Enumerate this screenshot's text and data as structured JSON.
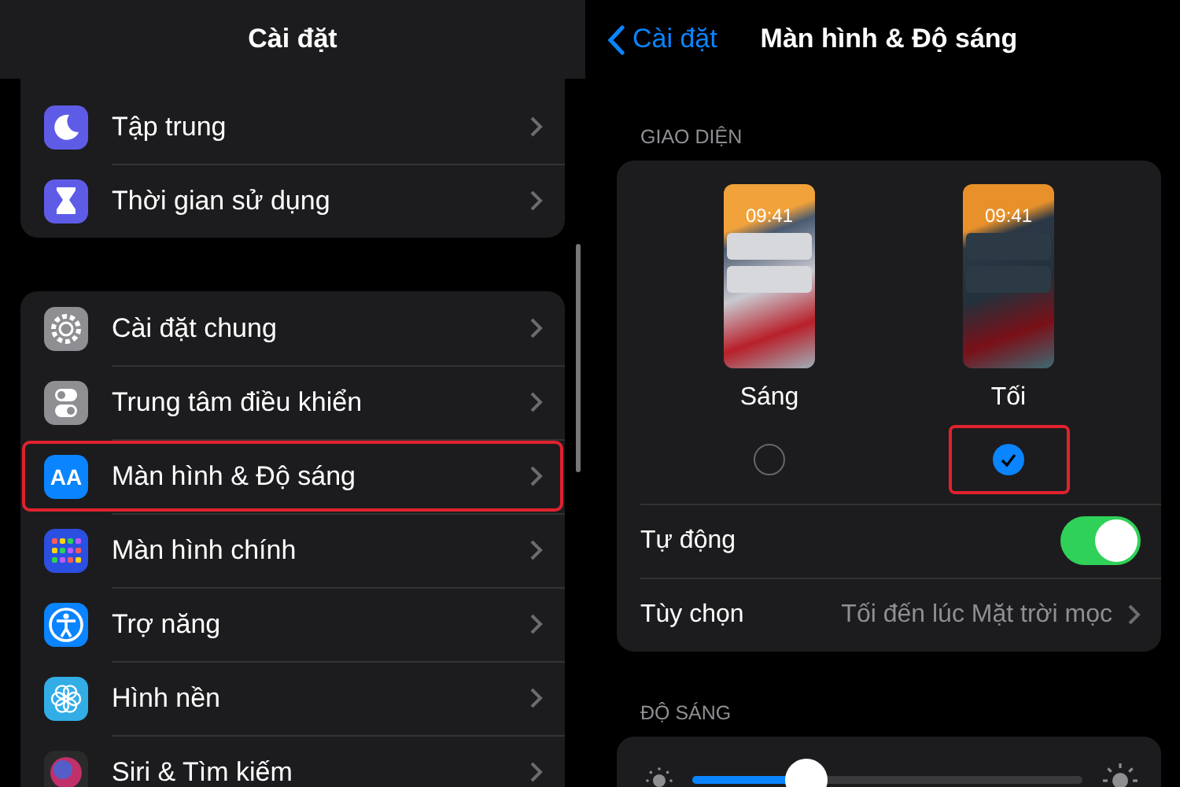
{
  "settings_pane": {
    "title": "Cài đặt",
    "groups": [
      {
        "items": [
          {
            "label": "Tập trung",
            "kind": "moon",
            "highlighted": false
          },
          {
            "label": "Thời gian sử dụng",
            "kind": "hourglass",
            "highlighted": false
          }
        ]
      },
      {
        "items": [
          {
            "label": "Cài đặt chung",
            "kind": "gear",
            "highlighted": false
          },
          {
            "label": "Trung tâm điều khiển",
            "kind": "toggles",
            "highlighted": false
          },
          {
            "label": "Màn hình & Độ sáng",
            "kind": "text",
            "icon_text": "AA",
            "highlighted": true
          },
          {
            "label": "Màn hình chính",
            "kind": "grid",
            "highlighted": false
          },
          {
            "label": "Trợ năng",
            "kind": "accessibility",
            "highlighted": false
          },
          {
            "label": "Hình nền",
            "kind": "flower",
            "highlighted": false
          },
          {
            "label": "Siri & Tìm kiếm",
            "kind": "siri",
            "highlighted": false
          }
        ]
      }
    ]
  },
  "display_pane": {
    "back_label": "Cài đặt",
    "title": "Màn hình & Độ sáng",
    "appearance": {
      "section_label": "GIAO DIỆN",
      "options": [
        {
          "label": "Sáng",
          "time": "09:41",
          "kind": "light",
          "selected": false,
          "highlighted": false
        },
        {
          "label": "Tối",
          "time": "09:41",
          "kind": "dark",
          "selected": true,
          "highlighted": true
        }
      ],
      "automatic": {
        "label": "Tự động",
        "on": true
      },
      "options_row": {
        "label": "Tùy chọn",
        "value": "Tối đến lúc Mặt trời mọc"
      }
    },
    "brightness": {
      "section_label": "ĐỘ SÁNG",
      "level": 0.29
    }
  }
}
